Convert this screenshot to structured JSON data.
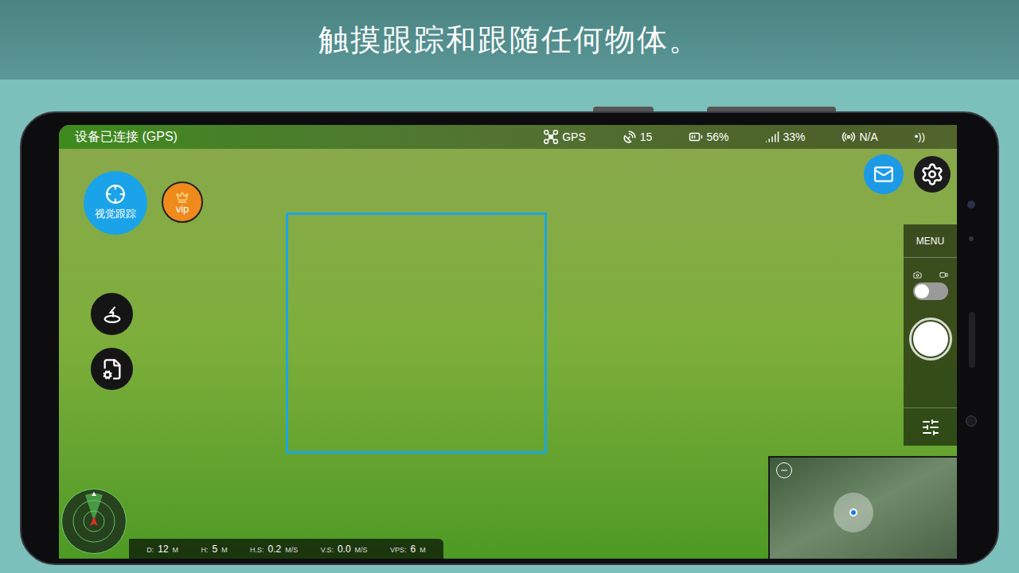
{
  "header": {
    "title": "触摸跟踪和跟随任何物体。"
  },
  "status_bar": {
    "connection": "设备已连接 (GPS)",
    "items": [
      {
        "label": "GPS"
      },
      {
        "label": "15"
      },
      {
        "label": "56%"
      },
      {
        "label": "33%"
      },
      {
        "label": "N/A"
      }
    ]
  },
  "left_buttons": {
    "tracking": "视觉跟踪",
    "vip": "vip"
  },
  "right_panel": {
    "menu": "MENU",
    "video_mode": false
  },
  "telemetry": [
    {
      "label": "D:",
      "value": "12",
      "unit": "M"
    },
    {
      "label": "H:",
      "value": "5",
      "unit": "M"
    },
    {
      "label": "H.S:",
      "value": "0.2",
      "unit": "M/S"
    },
    {
      "label": "V.S:",
      "value": "0.0",
      "unit": "M/S"
    },
    {
      "label": "VPS:",
      "value": "6",
      "unit": "M"
    }
  ]
}
